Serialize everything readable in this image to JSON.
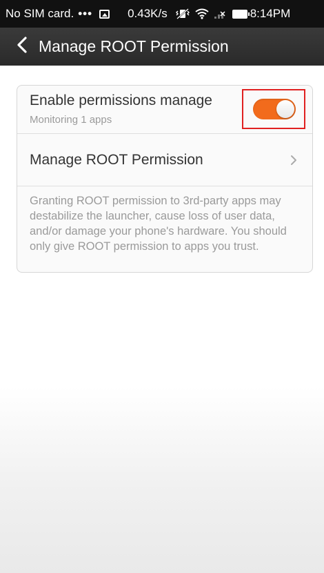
{
  "status_bar": {
    "carrier": "No SIM card.",
    "dots": "•••",
    "speed": "0.43K/s",
    "time": "8:14PM",
    "icons": [
      "image-notification-icon",
      "vibrate-icon",
      "wifi-icon",
      "signal-icon",
      "battery-icon"
    ]
  },
  "header": {
    "back_icon": "chevron-left-icon",
    "title": "Manage ROOT Permission"
  },
  "settings": {
    "enable_permissions": {
      "title": "Enable permissions manage",
      "subtitle": "Monitoring 1 apps",
      "toggle_state": "on",
      "toggle_color": "#f26b1c",
      "highlight_color": "#e02020"
    },
    "manage_root": {
      "title": "Manage ROOT Permission",
      "chevron_icon": "chevron-right-icon"
    },
    "disclaimer": "Granting ROOT permission to 3rd-party apps may destabilize the launcher, cause loss of user data, and/or damage your phone's hardware. You should only give ROOT permission to apps you trust."
  }
}
